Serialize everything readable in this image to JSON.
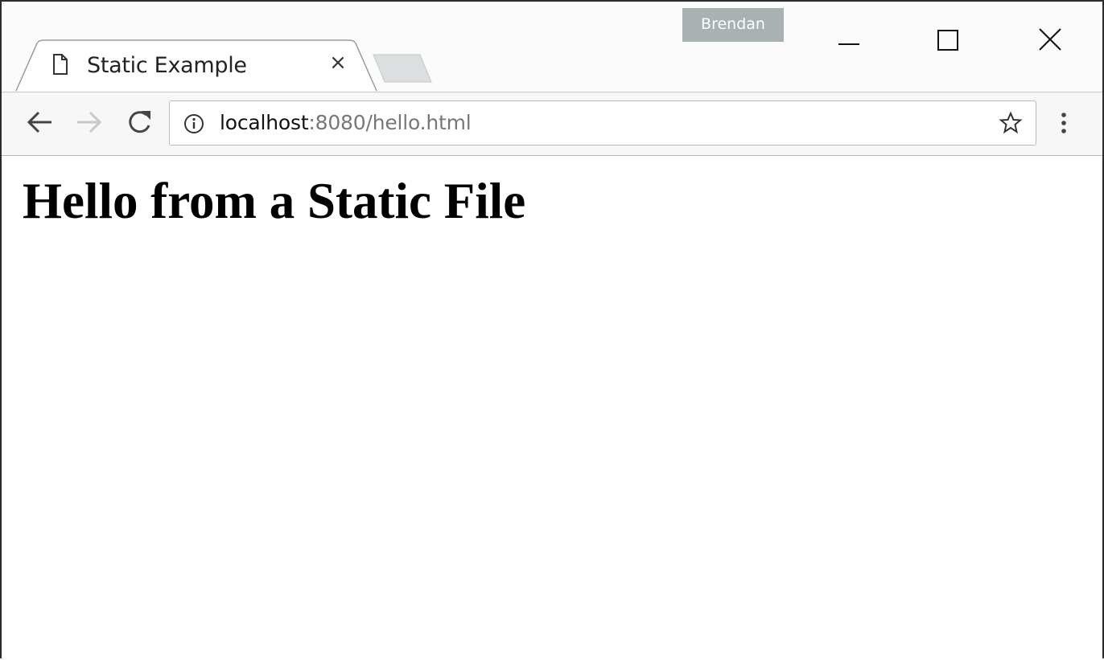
{
  "browser": {
    "profile_name": "Brendan",
    "tabs": [
      {
        "title": "Static Example",
        "close_label": "×",
        "icon": "page-icon"
      }
    ],
    "new_tab_icon": "new-tab-icon",
    "window_controls": [
      "minimize-icon",
      "maximize-icon",
      "close-icon"
    ]
  },
  "toolbar": {
    "back_icon": "back-arrow-icon",
    "forward_icon": "forward-arrow-icon",
    "reload_icon": "reload-icon",
    "address": {
      "security_icon": "info-icon",
      "host": "localhost",
      "rest": ":8080/hello.html"
    },
    "bookmark_icon": "star-icon",
    "menu_icon": "three-dots-menu-icon"
  },
  "page": {
    "heading": "Hello from a Static File"
  },
  "colors": {
    "titlebar": "#fbfbfb",
    "toolbar": "#f7f7f7",
    "profile_badge": "#a9b1b3",
    "url_muted": "#777777",
    "forward_disabled": "#c8c8c8"
  }
}
